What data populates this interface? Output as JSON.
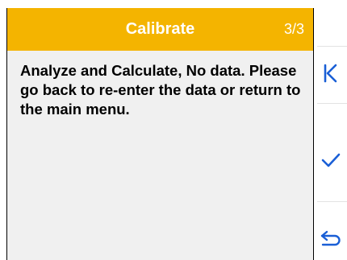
{
  "header": {
    "title": "Calibrate",
    "page_indicator": "3/3",
    "color": "#f4b400"
  },
  "message": "Analyze and Calculate, No data. Please go back to re-enter the data or return to the main menu.",
  "side_buttons": [
    {
      "icon": "skip-back-icon",
      "color": "#1a5fd6"
    },
    {
      "icon": "checkmark-icon",
      "color": "#1a5fd6"
    },
    {
      "icon": "return-icon",
      "color": "#1a5fd6"
    }
  ]
}
